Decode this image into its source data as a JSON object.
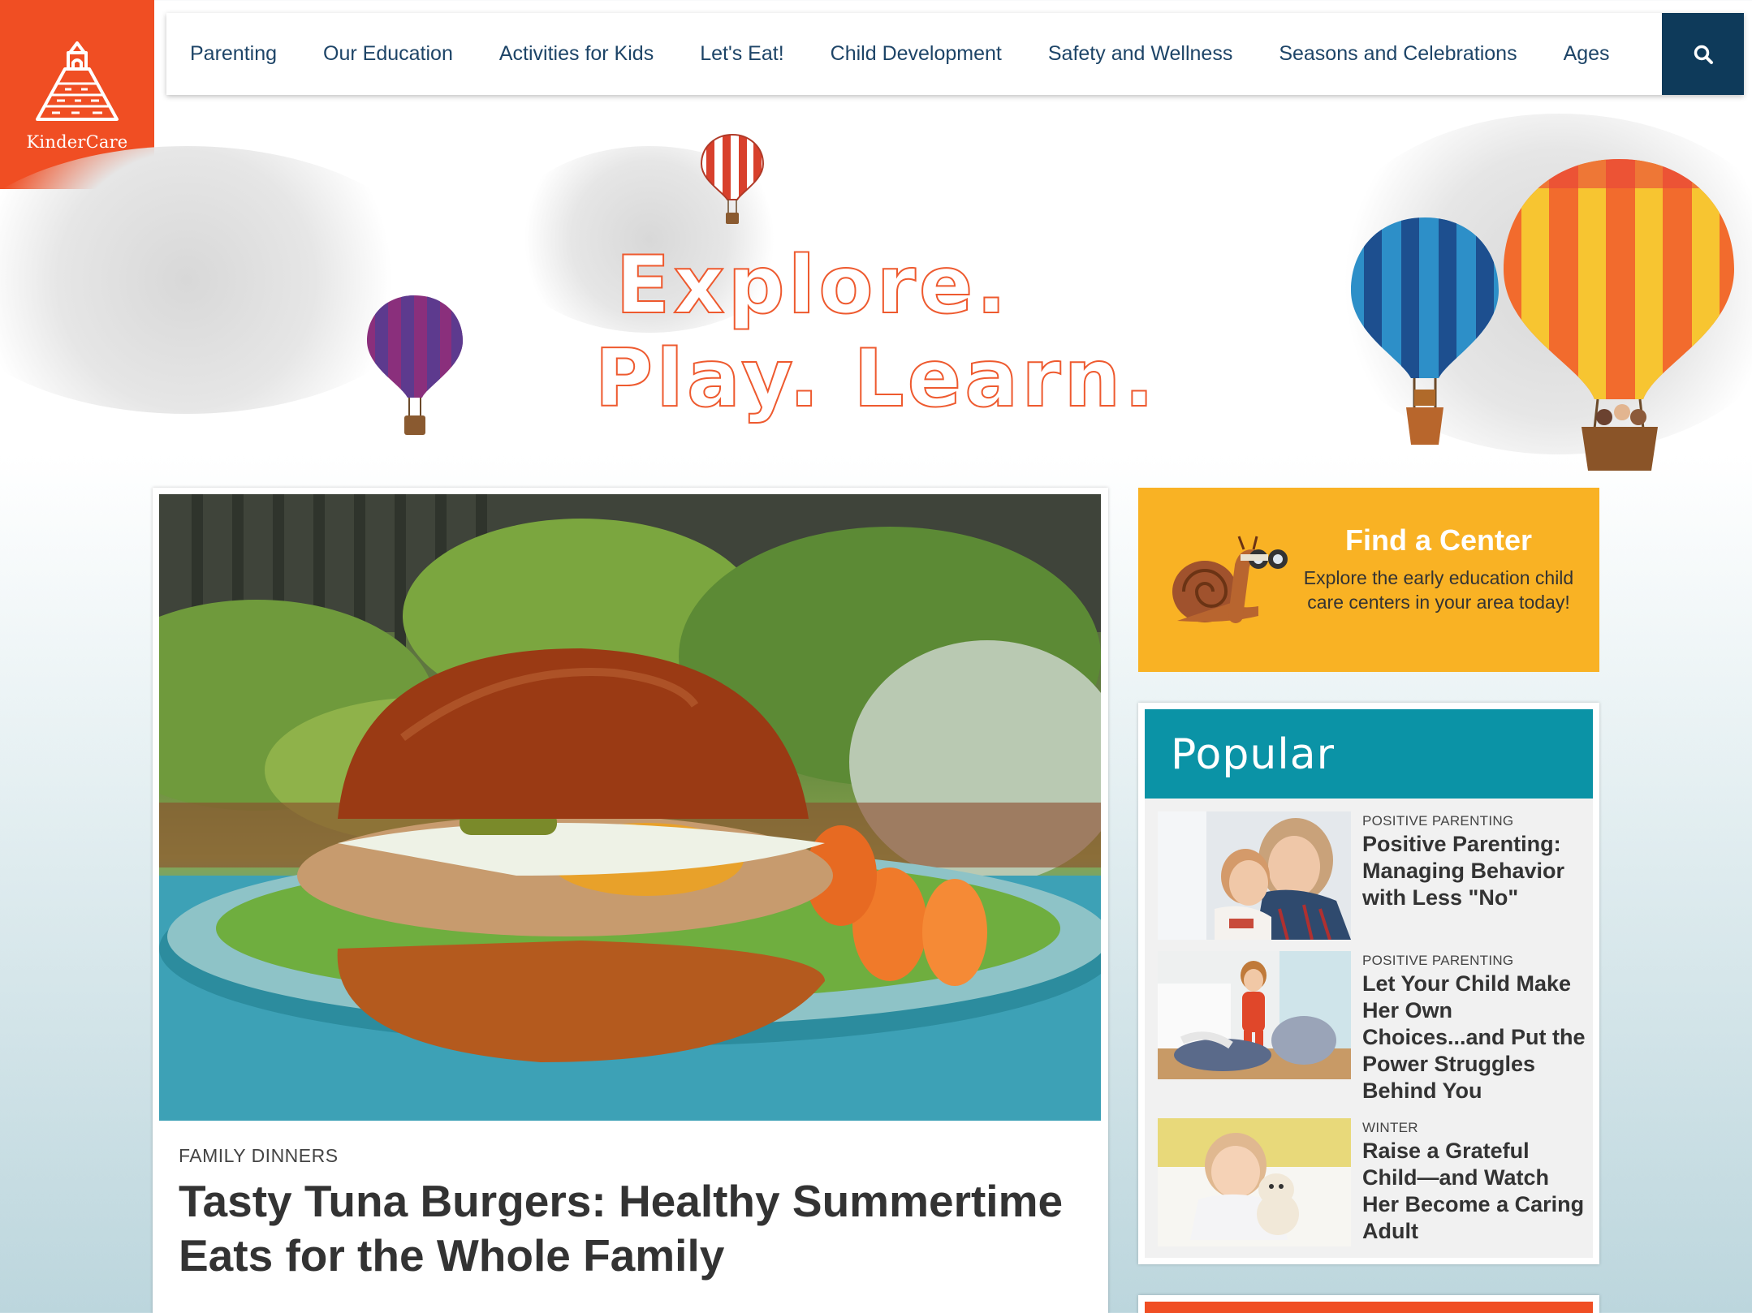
{
  "brand": {
    "name": "KinderCare",
    "color": "#f04e23"
  },
  "nav": {
    "items": [
      {
        "label": "Parenting"
      },
      {
        "label": "Our Education"
      },
      {
        "label": "Activities for Kids"
      },
      {
        "label": "Let's Eat!"
      },
      {
        "label": "Child Development"
      },
      {
        "label": "Safety and Wellness"
      },
      {
        "label": "Seasons and Celebrations"
      },
      {
        "label": "Ages"
      }
    ],
    "search_icon": "search-icon"
  },
  "hero": {
    "line1": "Explore.",
    "line2": "Play. Learn."
  },
  "featured": {
    "category": "FAMILY DINNERS",
    "title": "Tasty Tuna Burgers: Healthy Summertime Eats for the Whole Family"
  },
  "find_center": {
    "title": "Find a Center",
    "description": "Explore the early education child care centers in your area today!",
    "color": "#f9b224"
  },
  "popular": {
    "title": "Popular",
    "color": "#0b93a6",
    "items": [
      {
        "category": "POSITIVE PARENTING",
        "title": "Positive Parenting: Managing Behavior with Less \"No\""
      },
      {
        "category": "POSITIVE PARENTING",
        "title": "Let Your Child Make Her Own Choices...and Put the Power Struggles Behind You"
      },
      {
        "category": "WINTER",
        "title": "Raise a Grateful Child—and Watch Her Become a Caring Adult"
      }
    ]
  }
}
